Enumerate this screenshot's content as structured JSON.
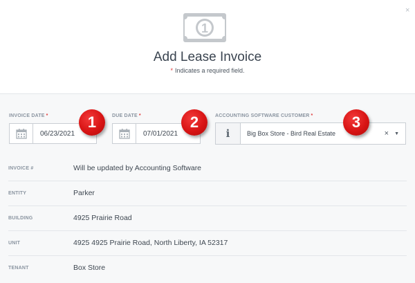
{
  "header": {
    "close_label": "×",
    "title": "Add Lease Invoice",
    "required_star": "*",
    "required_note": "Indicates a required field."
  },
  "icons": {
    "bill": "dollar-bill-icon",
    "calendar": "calendar-icon",
    "info": "info-icon"
  },
  "fields": {
    "invoice_date": {
      "label": "INVOICE DATE",
      "required": "*",
      "value": "06/23/2021"
    },
    "due_date": {
      "label": "DUE DATE",
      "required": "*",
      "value": "07/01/2021"
    },
    "customer": {
      "label": "ACCOUNTING SOFTWARE CUSTOMER",
      "required": "*",
      "value": "Big Box Store - Bird Real Estate",
      "addon": "i",
      "clear": "×",
      "caret": "▼"
    }
  },
  "badges": [
    "1",
    "2",
    "3"
  ],
  "details": [
    {
      "label": "INVOICE #",
      "value": "Will be updated by Accounting Software"
    },
    {
      "label": "ENTITY",
      "value": "Parker"
    },
    {
      "label": "BUILDING",
      "value": "4925 Prairie Road"
    },
    {
      "label": "UNIT",
      "value": "4925 4925 Prairie Road, North Liberty, IA 52317"
    },
    {
      "label": "TENANT",
      "value": "Box Store"
    }
  ],
  "colors": {
    "required": "#e03a3a",
    "badge": "#d81414",
    "body_bg": "#f7f8f9",
    "icon_gray": "#c4c8cc"
  }
}
